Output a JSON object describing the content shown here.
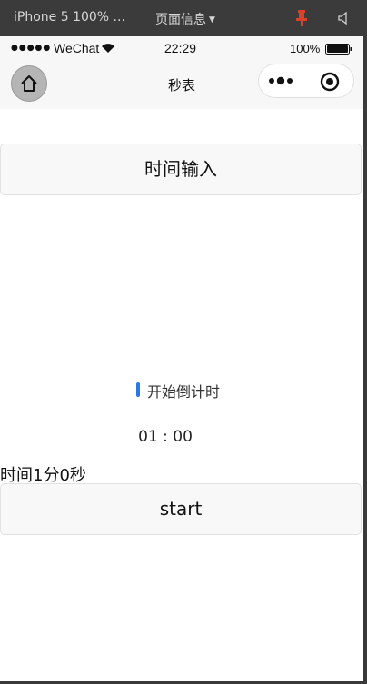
{
  "devtools": {
    "device_label": "iPhone 5 100% ...",
    "page_info_label": "页面信息"
  },
  "status_bar": {
    "carrier": "WeChat",
    "time": "22:29",
    "battery_percent": "100%"
  },
  "nav_bar": {
    "title": "秒表"
  },
  "main": {
    "time_input_label": "时间输入",
    "countdown_label": "开始倒计时",
    "clock_display": "01 : 00",
    "duration_text": "时间1分0秒",
    "start_label": "start"
  },
  "colors": {
    "accent": "#2b78e4",
    "devtools_bg": "#3b3b3b",
    "pin_red": "#d9412b"
  }
}
